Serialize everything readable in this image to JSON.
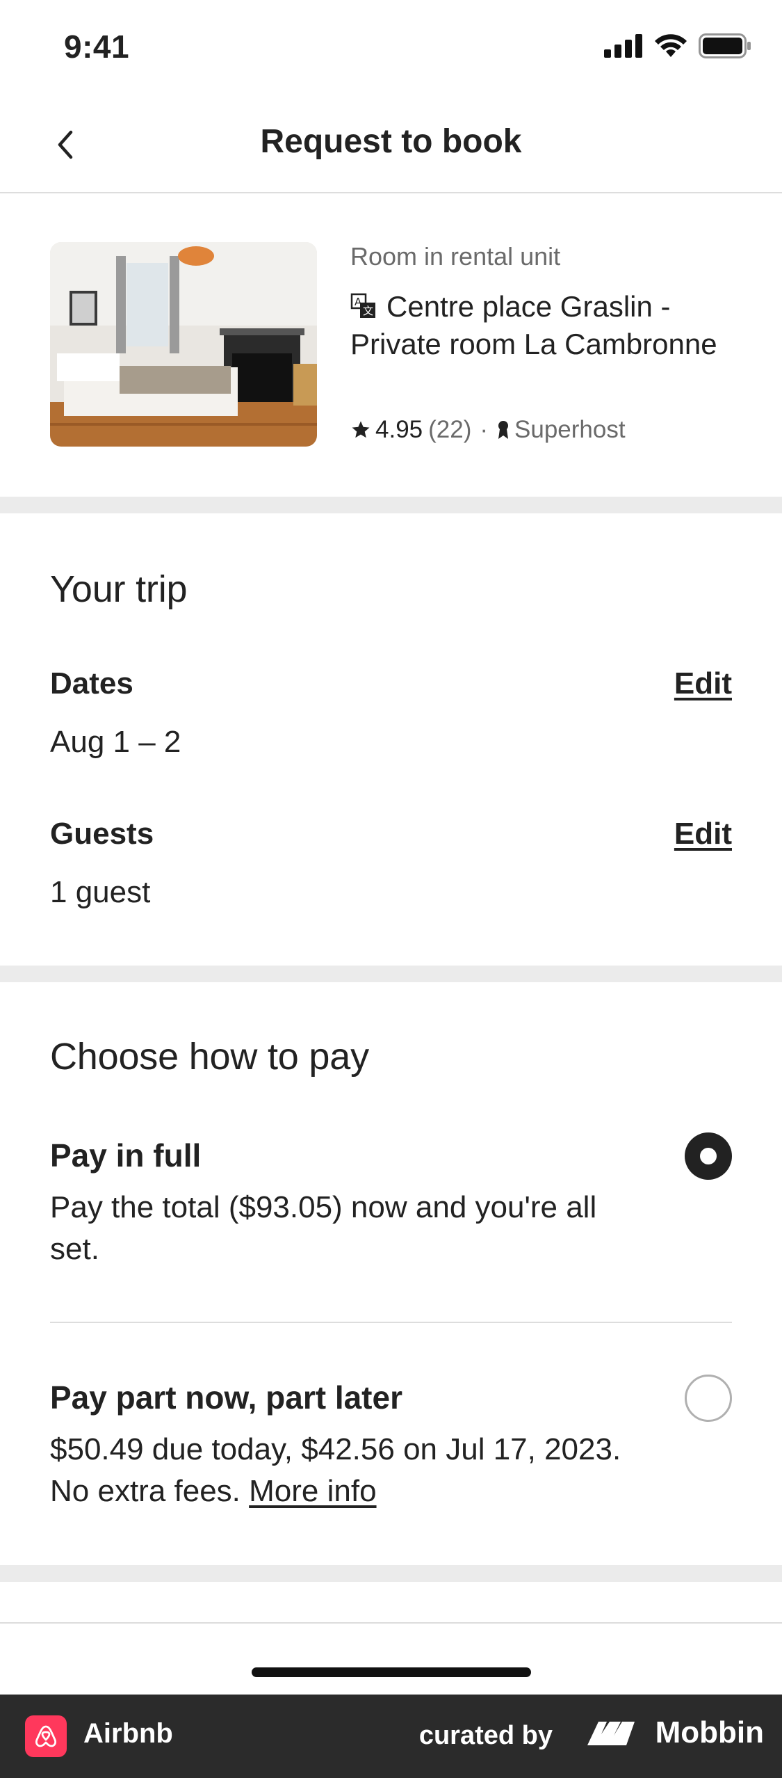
{
  "status_bar": {
    "time": "9:41"
  },
  "nav": {
    "title": "Request to book"
  },
  "listing": {
    "type": "Room in rental unit",
    "title": "Centre place Graslin - Private room La Cambronne",
    "rating": "4.95",
    "reviews": "(22)",
    "separator": "·",
    "badge": "Superhost"
  },
  "trip": {
    "title": "Your trip",
    "dates_label": "Dates",
    "dates_value": "Aug 1 – 2",
    "guests_label": "Guests",
    "guests_value": "1 guest",
    "edit_label": "Edit"
  },
  "payment": {
    "title": "Choose how to pay",
    "options": [
      {
        "label": "Pay in full",
        "description": "Pay the total ($93.05) now and you're all set.",
        "selected": true
      },
      {
        "label": "Pay part now, part later",
        "description": "$50.49 due today,  $42.56 on Jul 17, 2023. No extra fees.",
        "link": "More info",
        "selected": false
      }
    ]
  },
  "footer": {
    "app_name": "Airbnb",
    "curated_by": "curated by",
    "brand": "Mobbin"
  },
  "colors": {
    "text": "#222222",
    "muted": "#6a6a6a",
    "divider": "#ebebeb",
    "airbnb": "#ff385c",
    "footer_bg": "#2b2b2b"
  }
}
